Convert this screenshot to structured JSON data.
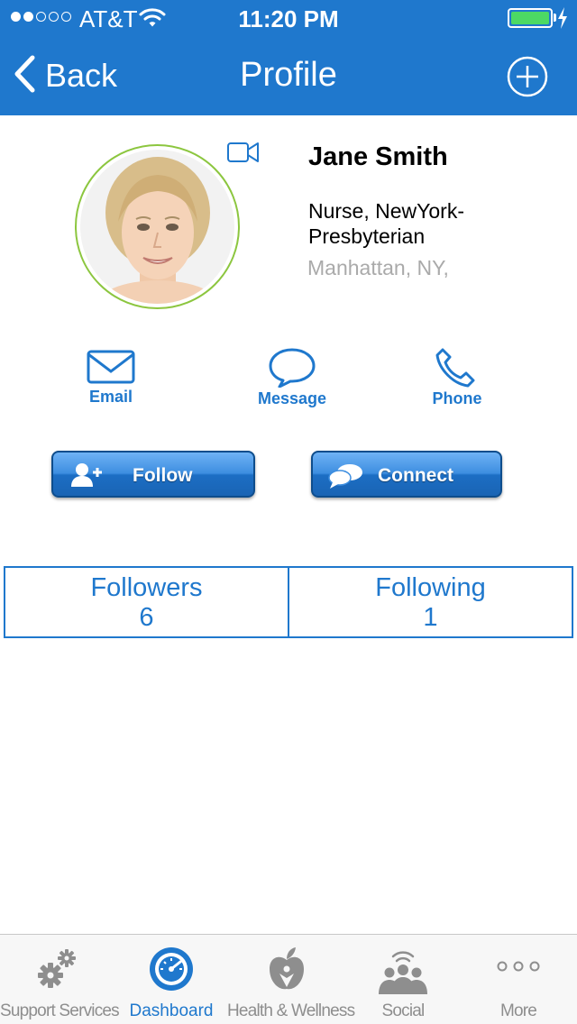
{
  "status_bar": {
    "carrier": "AT&T",
    "time": "11:20 PM"
  },
  "nav": {
    "back_label": "Back",
    "title": "Profile"
  },
  "profile": {
    "name": "Jane Smith",
    "job": "Nurse, NewYork-Presbyterian",
    "location": "Manhattan, NY,"
  },
  "actions": [
    {
      "label": "Email",
      "icon": "envelope-icon"
    },
    {
      "label": "Message",
      "icon": "speech-bubble-icon"
    },
    {
      "label": "Phone",
      "icon": "phone-icon"
    }
  ],
  "buttons": {
    "follow": "Follow",
    "connect": "Connect"
  },
  "stats": {
    "followers": {
      "label": "Followers",
      "value": "6"
    },
    "following": {
      "label": "Following",
      "value": "1"
    }
  },
  "tabs": [
    {
      "label": "Support Services",
      "icon": "gears-icon"
    },
    {
      "label": "Dashboard",
      "icon": "gauge-icon",
      "active": true
    },
    {
      "label": "Health & Wellness",
      "icon": "apple-icon"
    },
    {
      "label": "Social",
      "icon": "people-icon"
    },
    {
      "label": "More",
      "icon": "more-dots-icon"
    }
  ],
  "colors": {
    "brand": "#1f78cd",
    "avatar_ring": "#8cc63f",
    "battery": "#4cd964",
    "muted": "#aaaaaa"
  }
}
